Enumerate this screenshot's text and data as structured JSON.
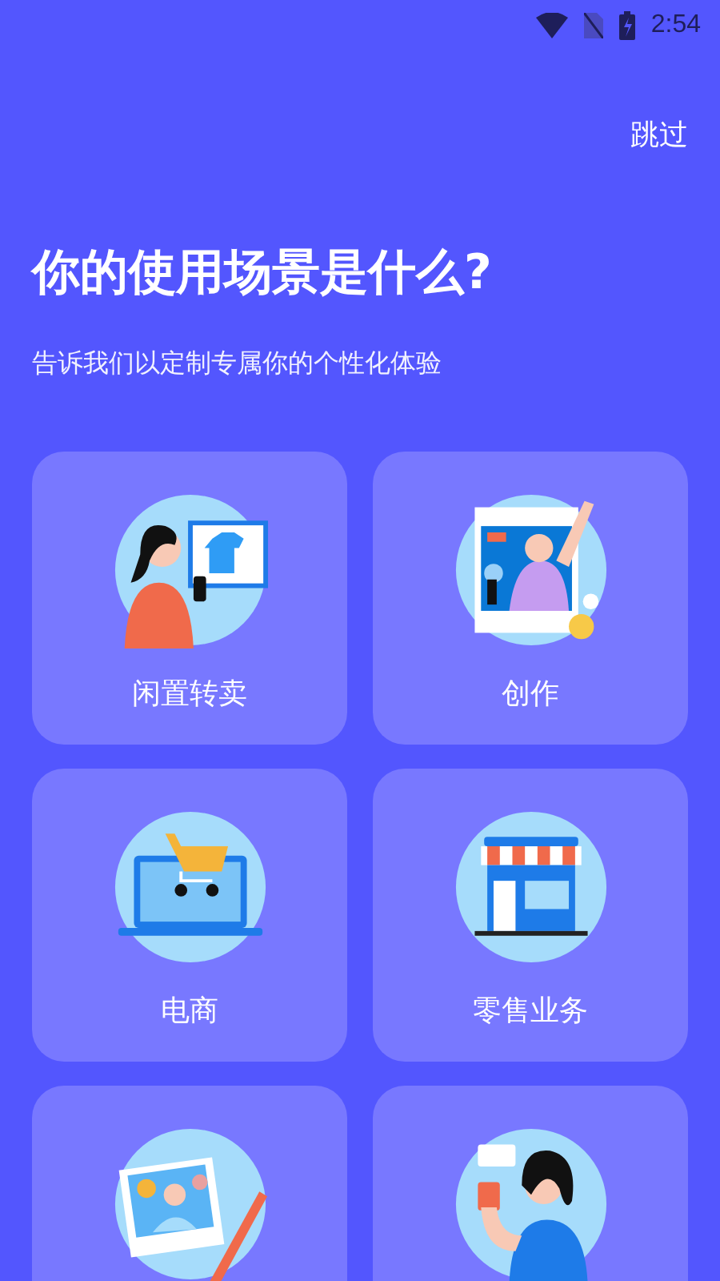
{
  "status_bar": {
    "time": "2:54"
  },
  "skip": "跳过",
  "title": "你的使用场景是什么?",
  "subtitle": "告诉我们以定制专属你的个性化体验",
  "cards": [
    {
      "kind": "resale",
      "label": "闲置转卖"
    },
    {
      "kind": "creation",
      "label": "创作"
    },
    {
      "kind": "ecommerce",
      "label": "电商"
    },
    {
      "kind": "retail",
      "label": "零售业务"
    },
    {
      "kind": "photo"
    },
    {
      "kind": "person"
    }
  ]
}
